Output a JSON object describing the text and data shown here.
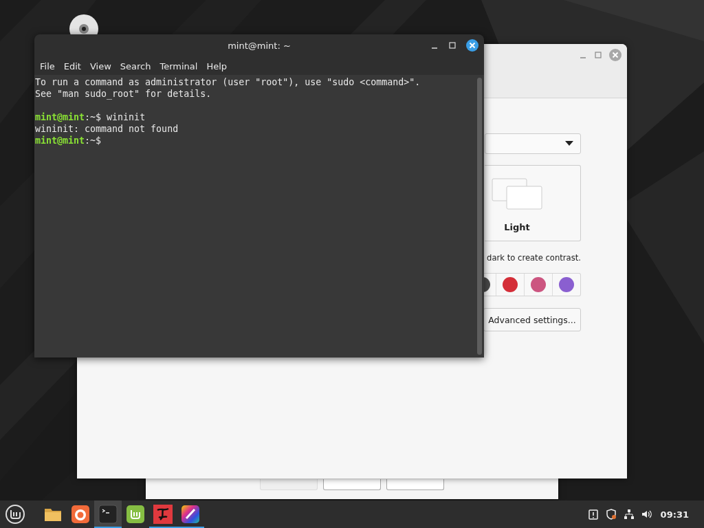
{
  "wizard": {
    "buttons": [
      {
        "disabled": true
      },
      {
        "disabled": false
      },
      {
        "disabled": false
      }
    ]
  },
  "welcome": {
    "theme_option": {
      "label": "Light"
    },
    "hint": "dark to create contrast.",
    "accent_colors": [
      {
        "color": "#4a4a4a"
      },
      {
        "color": "#d42e38"
      },
      {
        "color": "#cc5580"
      },
      {
        "color": "#8a5fd0"
      }
    ],
    "advanced_button": "Advanced settings..."
  },
  "terminal": {
    "title": "mint@mint: ~",
    "menu": [
      "File",
      "Edit",
      "View",
      "Search",
      "Terminal",
      "Help"
    ],
    "lines": [
      {
        "kind": "output",
        "text": "To run a command as administrator (user \"root\"), use \"sudo <command>\"."
      },
      {
        "kind": "output",
        "text": "See \"man sudo_root\" for details."
      },
      {
        "kind": "blank"
      },
      {
        "kind": "prompt",
        "user": "mint@mint",
        "path": ":~$",
        "command": "wininit"
      },
      {
        "kind": "output",
        "text": "wininit: command not found"
      },
      {
        "kind": "prompt",
        "user": "mint@mint",
        "path": ":~$"
      }
    ]
  },
  "taskbar": {
    "apps": [
      {
        "kind": "folder",
        "selected": false,
        "running": false
      },
      {
        "kind": "browser",
        "selected": false,
        "running": false
      },
      {
        "kind": "terminal",
        "selected": true,
        "running": true
      },
      {
        "kind": "update",
        "selected": false,
        "running": false
      },
      {
        "kind": "font",
        "selected": false,
        "running": true
      },
      {
        "kind": "paint",
        "selected": false,
        "running": true
      }
    ],
    "clock": "09:31"
  }
}
